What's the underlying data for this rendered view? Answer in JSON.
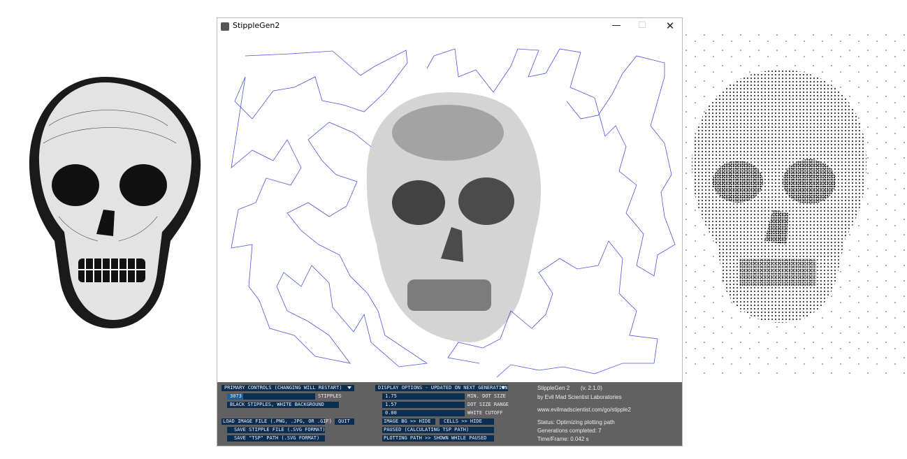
{
  "window": {
    "title": "StippleGen2"
  },
  "primary": {
    "dropdown": "PRIMARY CONTROLS (CHANGING WILL RESTART)",
    "stipples_value": "3073",
    "stipples_fraction": 0.18,
    "stipples_label": "STIPPLES",
    "bg_toggle": "BLACK STIPPLES, WHITE BACKGROUND",
    "load_button": "LOAD IMAGE FILE (.PNG, .JPG, OR .GIF)",
    "quit_button": "QUIT",
    "save_svg": "SAVE STIPPLE FILE (.SVG FORMAT)",
    "save_tsp": "SAVE \"TSP\" PATH (.SVG FORMAT)"
  },
  "display": {
    "dropdown": "DISPLAY OPTIONS - UPDATED ON NEXT GENERATION",
    "min_dot_value": "1.75",
    "min_dot_label": "MIN. DOT SIZE",
    "dot_range_value": "1.57",
    "dot_range_label": "DOT SIZE RANGE",
    "white_cutoff_value": "0.00",
    "white_cutoff_label": "WHITE CUTOFF",
    "image_bg": "IMAGE BG >> HIDE",
    "cells": "CELLS >> HIDE",
    "paused": "PAUSED (CALCULATING TSP PATH)",
    "plotting": "PLOTTING PATH >> SHOWN WHILE PAUSED"
  },
  "info": {
    "name": "StippleGen 2",
    "version": "(v. 2.1.0)",
    "by": "by Evil Mad Scientist Laboratories",
    "url": "www.evilmadscientist.com/go/stipple2",
    "status": "Status: Optimizing plotting path",
    "generations": "Generations completed: 7",
    "time": "Time/Frame: 0.042 s"
  },
  "colors": {
    "path": "#4a55e0",
    "controls_bg": "#616161",
    "control_fill": "#0b2d52",
    "slider_fill": "#1a5f9e"
  },
  "icons": {
    "minimize": "minimize-icon",
    "maximize": "maximize-icon",
    "close": "close-icon"
  }
}
